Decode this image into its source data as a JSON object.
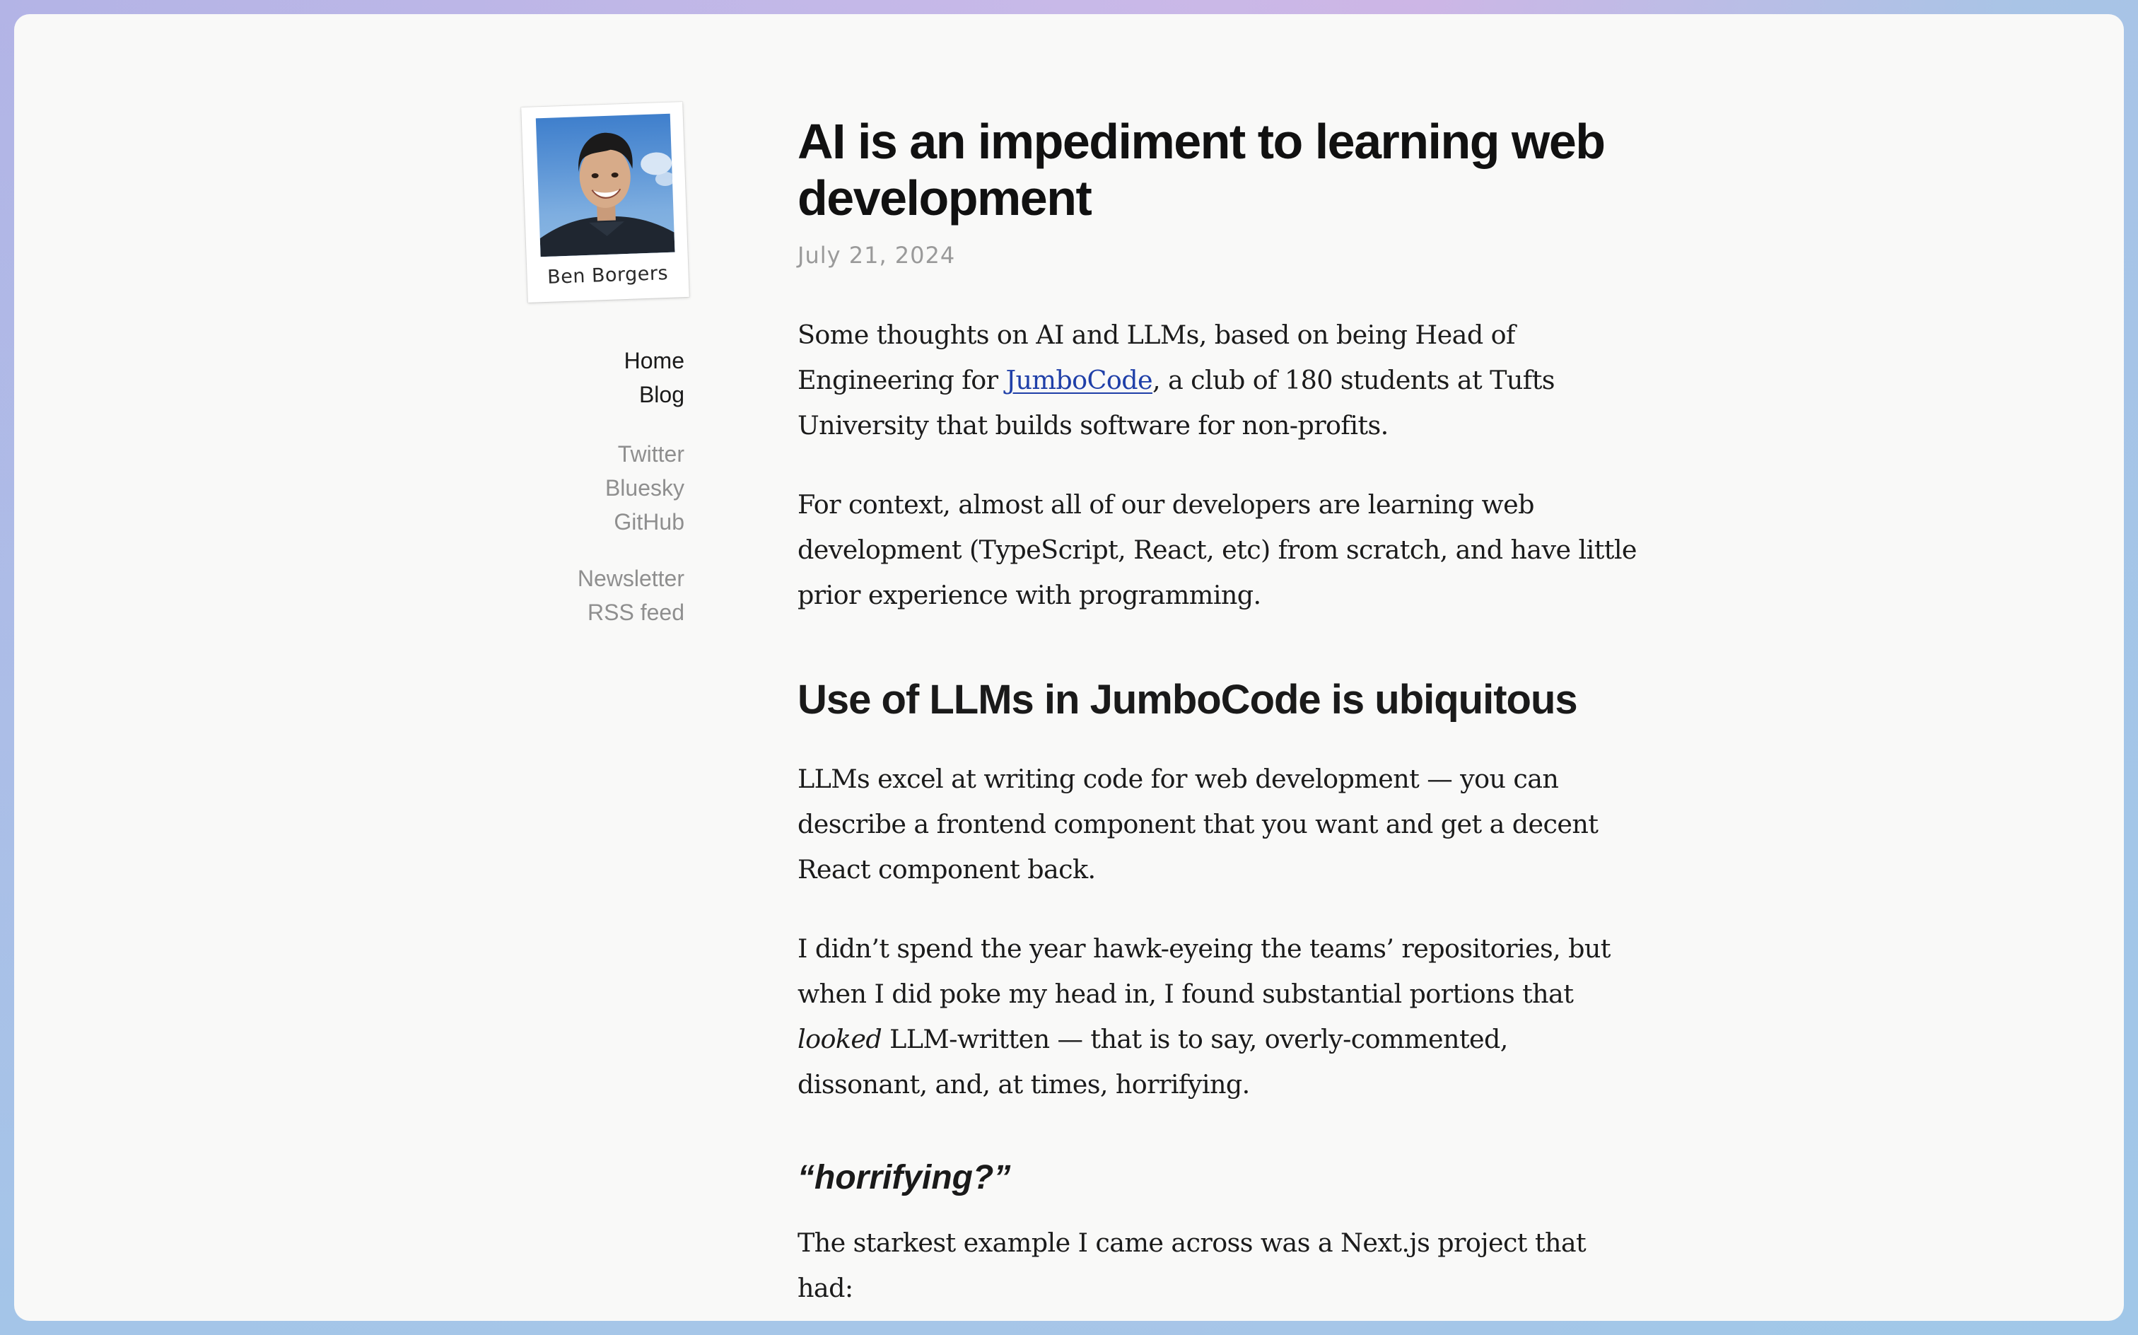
{
  "profile": {
    "caption": "Ben Borgers"
  },
  "nav": {
    "primary": [
      {
        "label": "Home"
      },
      {
        "label": "Blog"
      }
    ],
    "social": [
      {
        "label": "Twitter"
      },
      {
        "label": "Bluesky"
      },
      {
        "label": "GitHub"
      }
    ],
    "feeds": [
      {
        "label": "Newsletter"
      },
      {
        "label": "RSS feed"
      }
    ]
  },
  "article": {
    "title": "AI is an impediment to learning web development",
    "date": "July 21, 2024",
    "intro": {
      "before_link": "Some thoughts on AI and LLMs, based on being Head of Engineering for ",
      "link_text": "JumboCode",
      "after_link": ", a club of 180 students at Tufts University that builds software for non-profits."
    },
    "context": "For context, almost all of our developers are learning web development (TypeScript, React, etc) from scratch, and have little prior experience with programming.",
    "section_heading": "Use of LLMs in JumboCode is ubiquitous",
    "llm_paragraph": "LLMs excel at writing code for web development — you can describe a frontend component that you want and get a decent React component back.",
    "repo_paragraph": {
      "before_em": "I didn’t spend the year hawk-eyeing the teams’ repositories, but when I did poke my head in, I found substantial portions that ",
      "em": "looked",
      "after_em": " LLM-written — that is to say, overly-commented, dissonant, and, at times, horrifying."
    },
    "subheading": "“horrifying?”",
    "example_paragraph": "The starkest example I came across was a Next.js project that had:"
  },
  "colors": {
    "page_background": "#f9f9f8",
    "link": "#1f3fa8",
    "muted_text": "#8f8f8f",
    "date_text": "#9a9a9a"
  }
}
